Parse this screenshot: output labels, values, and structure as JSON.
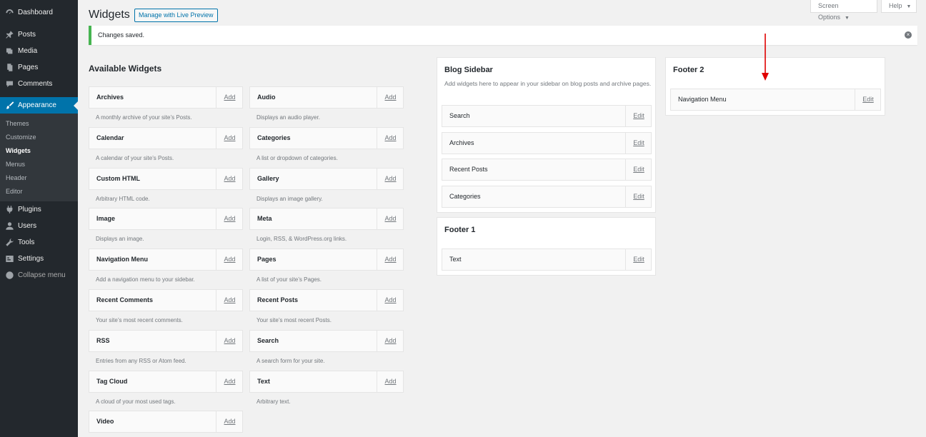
{
  "sidebar": {
    "items": [
      {
        "label": "Dashboard",
        "icon": "dashboard-icon"
      },
      {
        "label": "Posts",
        "icon": "pin-icon"
      },
      {
        "label": "Media",
        "icon": "media-icon"
      },
      {
        "label": "Pages",
        "icon": "pages-icon"
      },
      {
        "label": "Comments",
        "icon": "comment-icon"
      },
      {
        "label": "Appearance",
        "icon": "brush-icon"
      },
      {
        "label": "Plugins",
        "icon": "plug-icon"
      },
      {
        "label": "Users",
        "icon": "user-icon"
      },
      {
        "label": "Tools",
        "icon": "wrench-icon"
      },
      {
        "label": "Settings",
        "icon": "settings-icon"
      },
      {
        "label": "Collapse menu",
        "icon": "collapse-icon"
      }
    ],
    "submenu": [
      "Themes",
      "Customize",
      "Widgets",
      "Menus",
      "Header",
      "Editor"
    ]
  },
  "header": {
    "title": "Widgets",
    "live_preview": "Manage with Live Preview",
    "screen_options": "Screen Options",
    "help": "Help"
  },
  "notice": {
    "text": "Changes saved."
  },
  "available": {
    "title": "Available Widgets",
    "add_label": "Add",
    "left": [
      {
        "name": "Archives",
        "desc": "A monthly archive of your site’s Posts."
      },
      {
        "name": "Calendar",
        "desc": "A calendar of your site’s Posts."
      },
      {
        "name": "Custom HTML",
        "desc": "Arbitrary HTML code."
      },
      {
        "name": "Image",
        "desc": "Displays an image."
      },
      {
        "name": "Navigation Menu",
        "desc": "Add a navigation menu to your sidebar."
      },
      {
        "name": "Recent Comments",
        "desc": "Your site’s most recent comments."
      },
      {
        "name": "RSS",
        "desc": "Entries from any RSS or Atom feed."
      },
      {
        "name": "Tag Cloud",
        "desc": "A cloud of your most used tags."
      },
      {
        "name": "Video",
        "desc": ""
      }
    ],
    "right": [
      {
        "name": "Audio",
        "desc": "Displays an audio player."
      },
      {
        "name": "Categories",
        "desc": "A list or dropdown of categories."
      },
      {
        "name": "Gallery",
        "desc": "Displays an image gallery."
      },
      {
        "name": "Meta",
        "desc": "Login, RSS, & WordPress.org links."
      },
      {
        "name": "Pages",
        "desc": "A list of your site’s Pages."
      },
      {
        "name": "Recent Posts",
        "desc": "Your site’s most recent Posts."
      },
      {
        "name": "Search",
        "desc": "A search form for your site."
      },
      {
        "name": "Text",
        "desc": "Arbitrary text."
      }
    ]
  },
  "areas": {
    "edit_label": "Edit",
    "blog_sidebar": {
      "title": "Blog Sidebar",
      "desc": "Add widgets here to appear in your sidebar on blog posts and archive pages.",
      "widgets": [
        "Search",
        "Archives",
        "Recent Posts",
        "Categories"
      ]
    },
    "footer1": {
      "title": "Footer 1",
      "widgets": [
        "Text"
      ]
    },
    "footer2": {
      "title": "Footer 2",
      "widgets": [
        "Navigation Menu"
      ]
    }
  },
  "colors": {
    "accent": "#0073aa",
    "sidebar_bg": "#23282d",
    "success": "#46b450",
    "annotation": "#e00000"
  }
}
